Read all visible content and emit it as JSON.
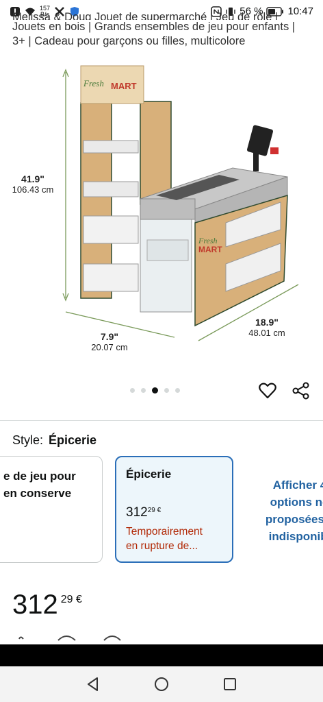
{
  "status_bar": {
    "speed_value": "157",
    "speed_unit": "B/s",
    "battery_percent": "56 %",
    "time": "10:47"
  },
  "product": {
    "title_line0": "Melissa & Doug Jouet de supermarché | Jeu de rôle |",
    "title_line1": "Jouets en bois | Grands ensembles de jeu pour enfants |",
    "title_line2": "3+ | Cadeau pour garçons ou filles, multicolore",
    "sign_text_fresh": "Fresh",
    "sign_text_mart": "MART",
    "dimensions": {
      "height_in": "41.9\"",
      "height_cm": "106.43 cm",
      "depth_in": "7.9\"",
      "depth_cm": "20.07 cm",
      "width_in": "18.9\"",
      "width_cm": "48.01 cm"
    }
  },
  "style_selector": {
    "label": "Style:",
    "selected": "Épicerie",
    "option1_line1": "e de jeu pour",
    "option1_line2": "en conserve",
    "option2_name": "Épicerie",
    "option2_price_whole": "312",
    "option2_price_fraction": "29 €",
    "option2_stock_line1": "Temporairement",
    "option2_stock_line2": "en rupture de...",
    "more_line1": "Afficher 4",
    "more_line2": "options no",
    "more_line3": "proposées e",
    "more_line4": "indisponibl"
  },
  "price": {
    "whole": "312",
    "fraction": "29 €"
  },
  "carousel": {
    "dot_count": 5,
    "active_index": 2
  },
  "colors": {
    "accent_blue": "#2a6eb8",
    "price_red": "#b12704",
    "link_blue": "#2162a1"
  }
}
